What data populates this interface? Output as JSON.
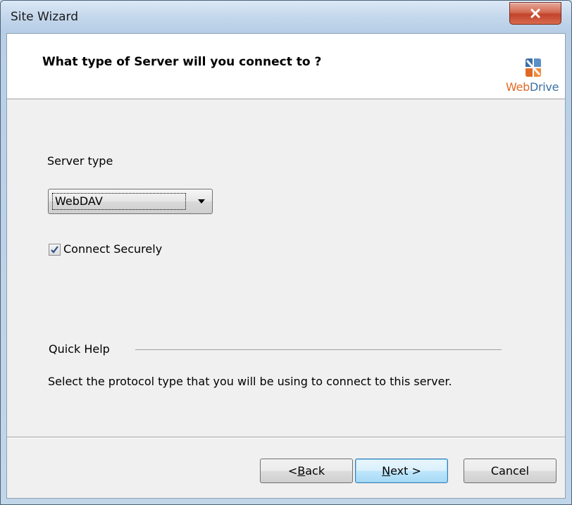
{
  "window": {
    "title": "Site Wizard"
  },
  "header": {
    "heading": "What type of Server will you connect to ?",
    "logo": {
      "text_part1": "Web",
      "text_part2": "Drive",
      "icon": "webdrive-logo-icon"
    }
  },
  "form": {
    "server_type_label": "Server type",
    "server_type_value": "WebDAV",
    "connect_securely_label": "Connect Securely",
    "connect_securely_checked": true
  },
  "quick_help": {
    "title": "Quick Help",
    "text": "Select the protocol type that you will be using to connect to this server."
  },
  "buttons": {
    "back_prefix": "< ",
    "back_mnemonic": "B",
    "back_rest": "ack",
    "next_mnemonic": "N",
    "next_rest": "ext >",
    "cancel": "Cancel"
  },
  "colors": {
    "close_button": "#c2432a",
    "logo_orange": "#e06a25",
    "logo_blue": "#3b6fa6",
    "default_button_border": "#3c7fb1"
  }
}
